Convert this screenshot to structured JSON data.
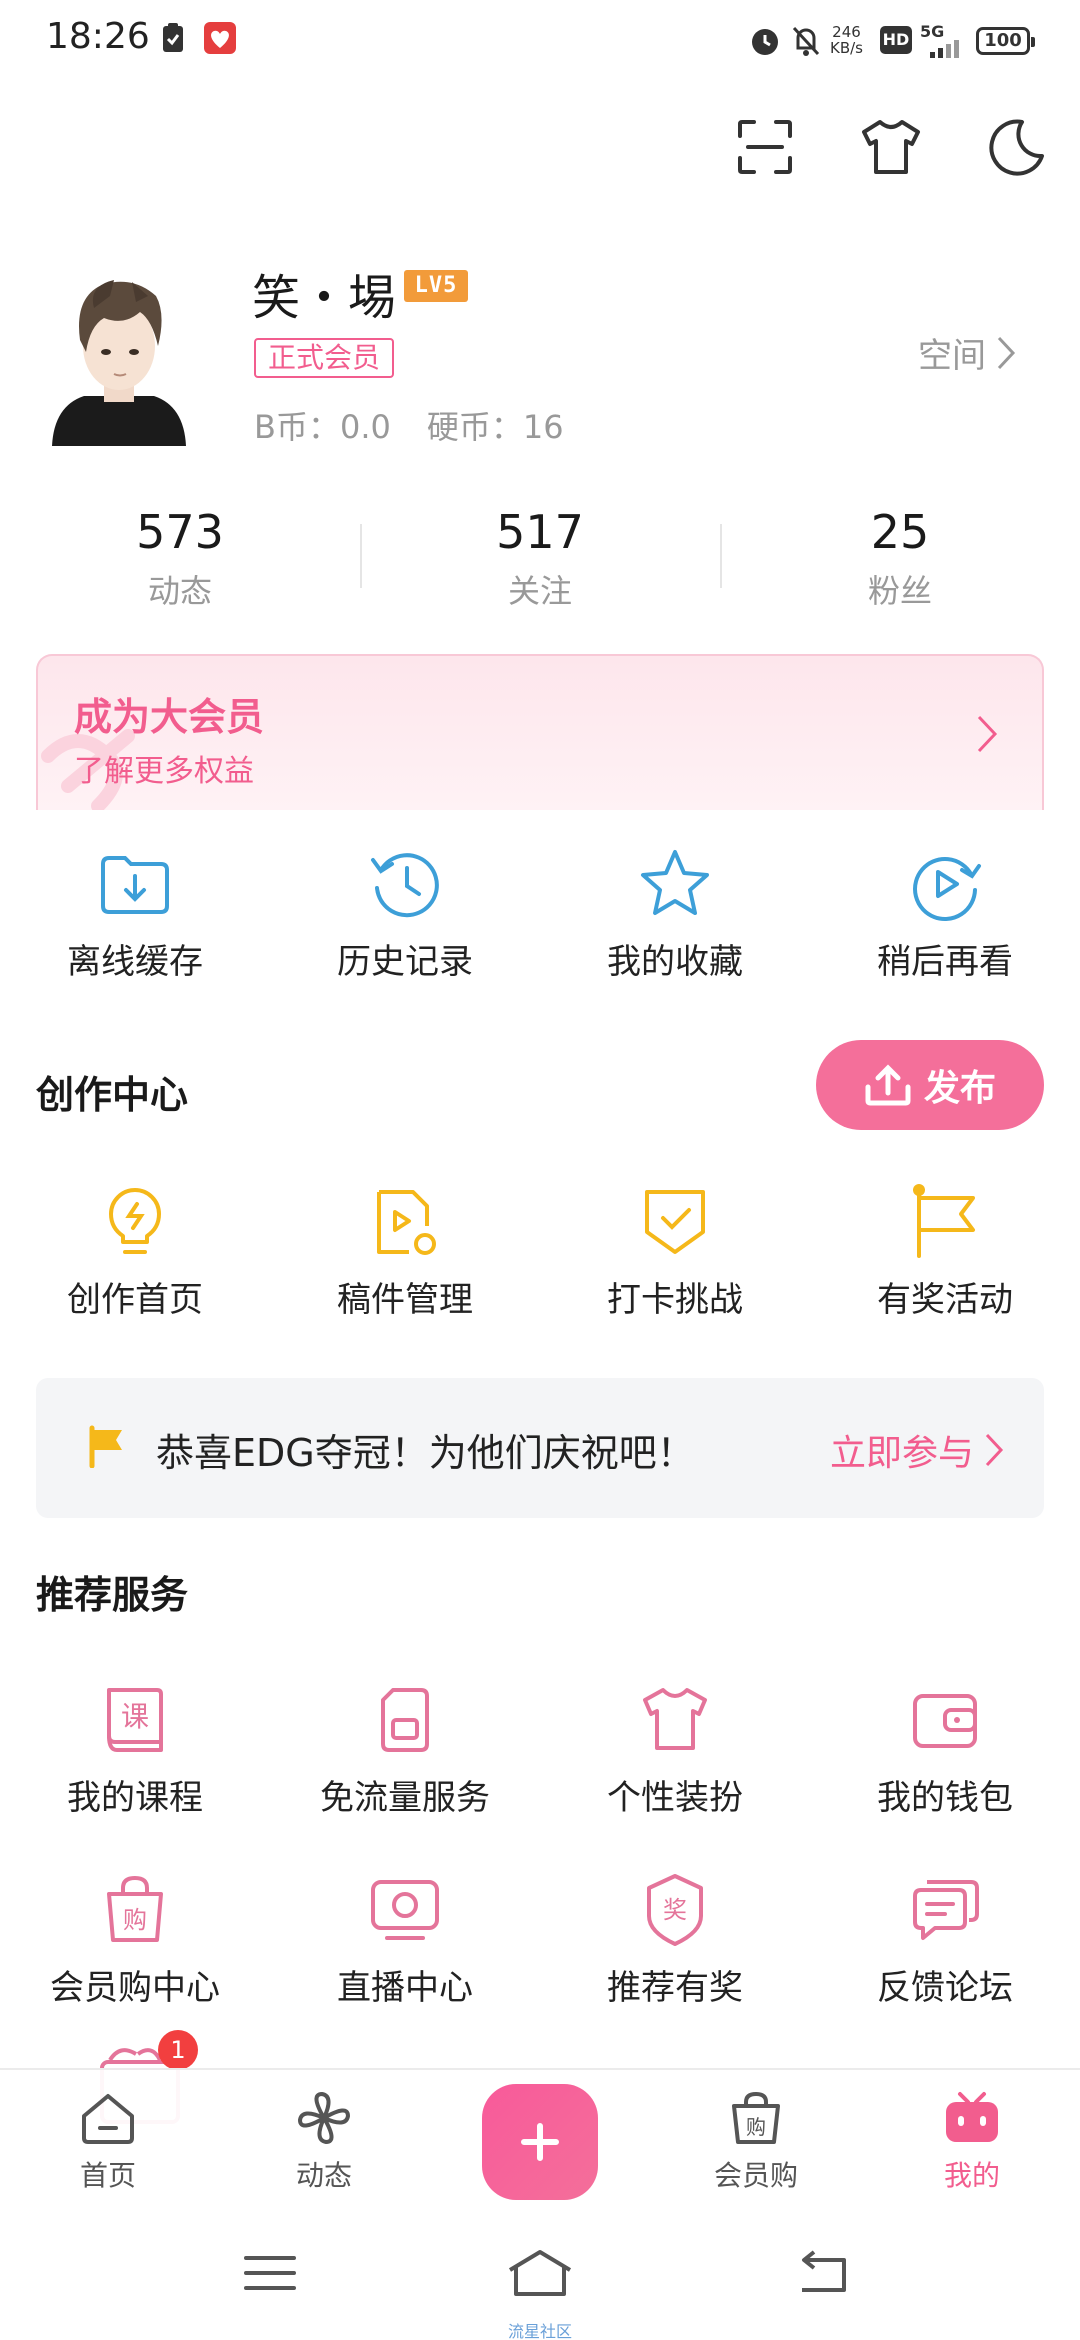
{
  "status_bar": {
    "time": "18:26",
    "net_speed_value": "246",
    "net_speed_unit": "KB/s",
    "hd": "HD",
    "signal": "5G",
    "battery": "100"
  },
  "profile": {
    "username": "笑・埸",
    "level": "LV5",
    "vip_tag": "正式会员",
    "b_coin": "B币：0.0",
    "hard_coin": "硬币：16",
    "space_link": "空间"
  },
  "stats": [
    {
      "value": "573",
      "label": "动态"
    },
    {
      "value": "517",
      "label": "关注"
    },
    {
      "value": "25",
      "label": "粉丝"
    }
  ],
  "vip_banner": {
    "title": "成为大会员",
    "subtitle": "了解更多权益"
  },
  "quick_actions": [
    {
      "label": "离线缓存",
      "icon": "offline-cache-icon"
    },
    {
      "label": "历史记录",
      "icon": "history-icon"
    },
    {
      "label": "我的收藏",
      "icon": "favorites-star-icon"
    },
    {
      "label": "稍后再看",
      "icon": "watch-later-icon"
    }
  ],
  "creation": {
    "title": "创作中心",
    "publish_label": "发布",
    "items": [
      {
        "label": "创作首页",
        "icon": "lightbulb-icon"
      },
      {
        "label": "稿件管理",
        "icon": "manuscript-icon"
      },
      {
        "label": "打卡挑战",
        "icon": "check-in-shield-icon"
      },
      {
        "label": "有奖活动",
        "icon": "flag-icon"
      }
    ]
  },
  "event_banner": {
    "text": "恭喜EDG夺冠！为他们庆祝吧！",
    "cta": "立即参与"
  },
  "services": {
    "title": "推荐服务",
    "items": [
      {
        "label": "我的课程",
        "icon": "course-book-icon"
      },
      {
        "label": "免流量服务",
        "icon": "sim-card-icon"
      },
      {
        "label": "个性装扮",
        "icon": "tshirt-icon"
      },
      {
        "label": "我的钱包",
        "icon": "wallet-icon"
      },
      {
        "label": "会员购中心",
        "icon": "shopping-bag-icon"
      },
      {
        "label": "直播中心",
        "icon": "live-tv-icon"
      },
      {
        "label": "推荐有奖",
        "icon": "reward-badge-icon"
      },
      {
        "label": "反馈论坛",
        "icon": "feedback-chat-icon"
      }
    ]
  },
  "notification_badge": "1",
  "bottom_nav": {
    "items": [
      {
        "label": "首页"
      },
      {
        "label": "动态"
      },
      {
        "label": "会员购"
      },
      {
        "label": "我的"
      }
    ]
  },
  "system_caption": "流星社区",
  "colors": {
    "brand_pink": "#f25d8e",
    "blue_icon": "#3d9fd8",
    "yellow_icon": "#f5b81a",
    "pink_icon": "#e4749a"
  }
}
